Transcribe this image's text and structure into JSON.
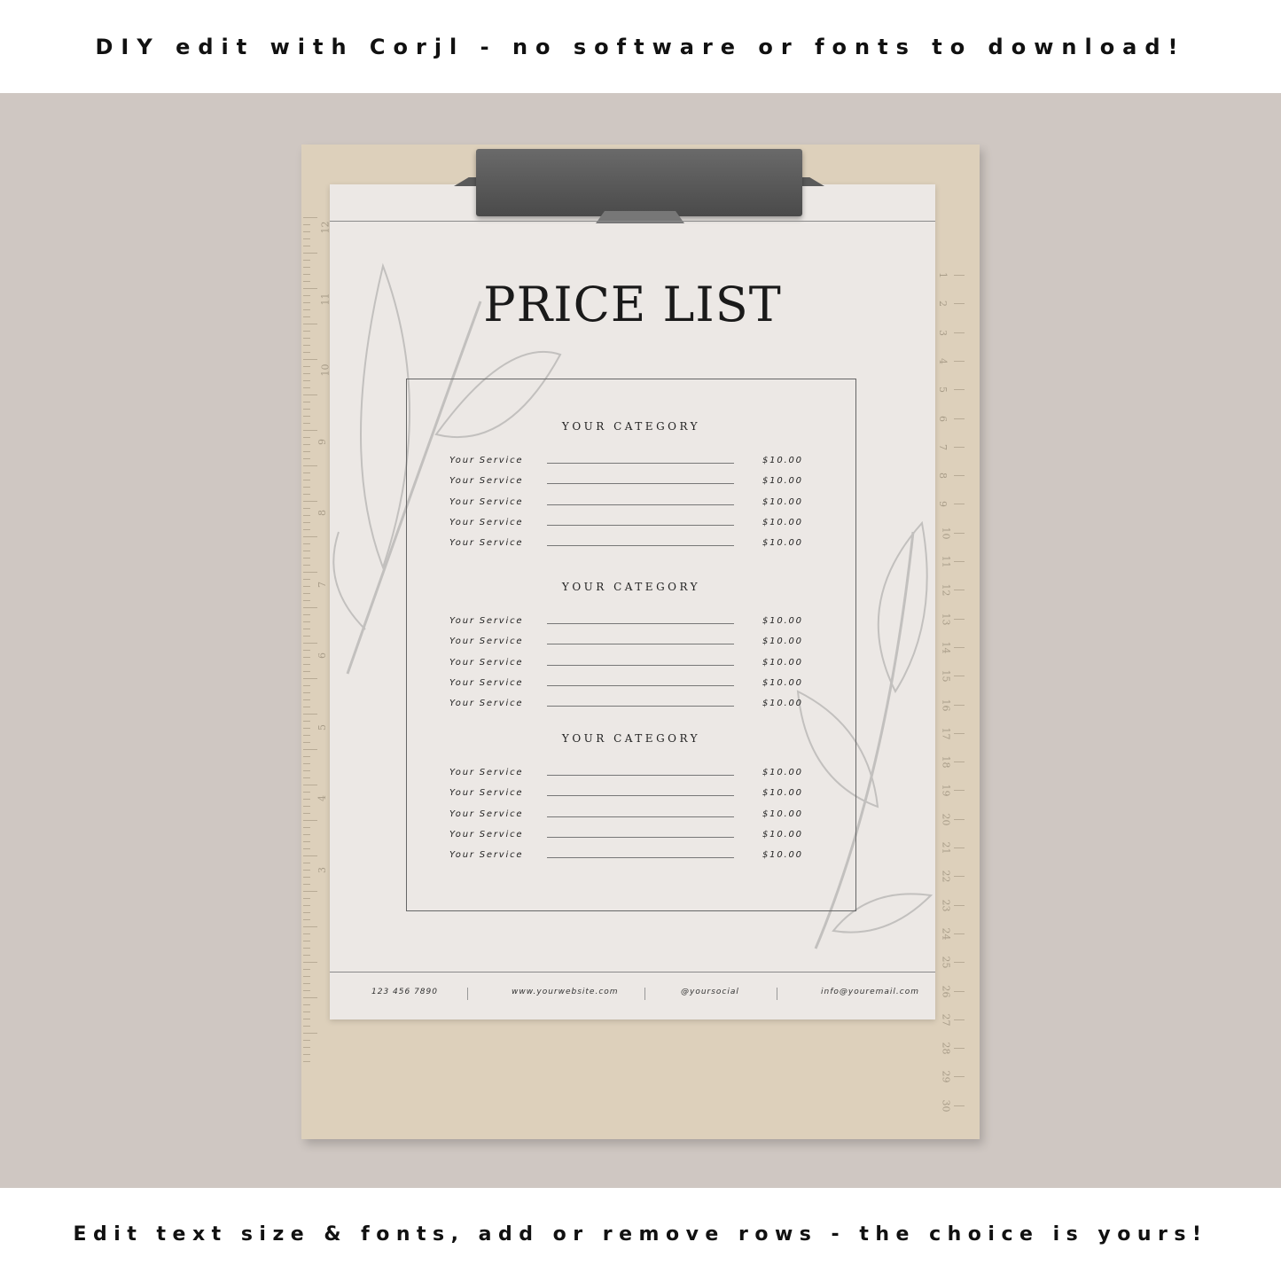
{
  "banner_top": "DIY edit with Corjl - no software or fonts to download!",
  "banner_bottom": "Edit text size & fonts, add or remove rows - the choice is yours!",
  "document": {
    "title": "PRICE LIST",
    "sections": [
      {
        "category": "YOUR CATEGORY",
        "items": [
          {
            "service": "Your Service",
            "price": "$10.00"
          },
          {
            "service": "Your Service",
            "price": "$10.00"
          },
          {
            "service": "Your Service",
            "price": "$10.00"
          },
          {
            "service": "Your Service",
            "price": "$10.00"
          },
          {
            "service": "Your Service",
            "price": "$10.00"
          }
        ]
      },
      {
        "category": "YOUR CATEGORY",
        "items": [
          {
            "service": "Your Service",
            "price": "$10.00"
          },
          {
            "service": "Your Service",
            "price": "$10.00"
          },
          {
            "service": "Your Service",
            "price": "$10.00"
          },
          {
            "service": "Your Service",
            "price": "$10.00"
          },
          {
            "service": "Your Service",
            "price": "$10.00"
          }
        ]
      },
      {
        "category": "YOUR CATEGORY",
        "items": [
          {
            "service": "Your Service",
            "price": "$10.00"
          },
          {
            "service": "Your Service",
            "price": "$10.00"
          },
          {
            "service": "Your Service",
            "price": "$10.00"
          },
          {
            "service": "Your Service",
            "price": "$10.00"
          },
          {
            "service": "Your Service",
            "price": "$10.00"
          }
        ]
      }
    ],
    "footer": {
      "phone": "123 456 7890",
      "website": "www.yourwebsite.com",
      "social": "@yoursocial",
      "email": "info@youremail.com"
    }
  },
  "ruler_right": [
    "1",
    "2",
    "3",
    "4",
    "5",
    "6",
    "7",
    "8",
    "9",
    "10",
    "11",
    "12",
    "13",
    "14",
    "15",
    "16",
    "17",
    "18",
    "19",
    "20",
    "21",
    "22",
    "23",
    "24",
    "25",
    "26",
    "27",
    "28",
    "29",
    "30"
  ],
  "ruler_left": [
    "12",
    "11",
    "10",
    "9",
    "8",
    "7",
    "6",
    "5",
    "4",
    "3"
  ]
}
